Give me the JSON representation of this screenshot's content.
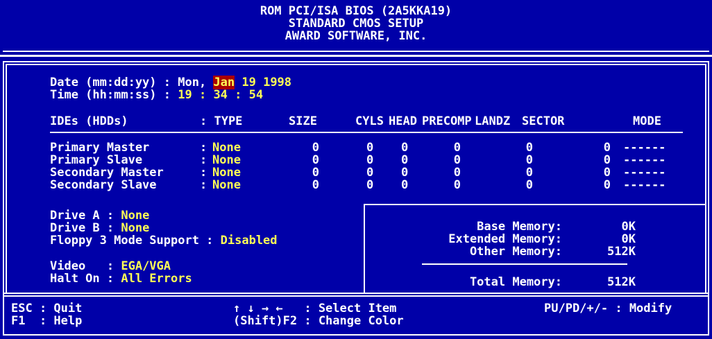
{
  "header": {
    "line1": "ROM PCI/ISA BIOS (2A5KKA19)",
    "line2": "STANDARD CMOS SETUP",
    "line3": "AWARD SOFTWARE, INC."
  },
  "datetime": {
    "date_label": "Date (mm:dd:yy) : ",
    "date_day": "Mon, ",
    "date_month": "Jan",
    "date_rest": " 19 1998",
    "time_label": "Time (hh:mm:ss) : ",
    "time_h": "19",
    "time_sep1": " : ",
    "time_m": "34",
    "time_sep2": " : ",
    "time_s": "54"
  },
  "ide": {
    "headers": [
      "IDEs (HDDs)",
      ": TYPE",
      "SIZE",
      "CYLS",
      "HEAD",
      "PRECOMP",
      "LANDZ",
      "SECTOR",
      "MODE"
    ],
    "rows": [
      {
        "name": "Primary Master",
        "type": "None",
        "size": "0",
        "cyls": "0",
        "head": "0",
        "precomp": "0",
        "landz": "0",
        "sector": "0",
        "mode": "------"
      },
      {
        "name": "Primary Slave",
        "type": "None",
        "size": "0",
        "cyls": "0",
        "head": "0",
        "precomp": "0",
        "landz": "0",
        "sector": "0",
        "mode": "------"
      },
      {
        "name": "Secondary Master",
        "type": "None",
        "size": "0",
        "cyls": "0",
        "head": "0",
        "precomp": "0",
        "landz": "0",
        "sector": "0",
        "mode": "------"
      },
      {
        "name": "Secondary Slave",
        "type": "None",
        "size": "0",
        "cyls": "0",
        "head": "0",
        "precomp": "0",
        "landz": "0",
        "sector": "0",
        "mode": "------"
      }
    ]
  },
  "drives": {
    "drive_a_label": "Drive A : ",
    "drive_a_value": "None",
    "drive_b_label": "Drive B : ",
    "drive_b_value": "None",
    "floppy_label": "Floppy 3 Mode Support : ",
    "floppy_value": "Disabled",
    "video_label": "Video   : ",
    "video_value": "EGA/VGA",
    "halt_label": "Halt On : ",
    "halt_value": "All Errors"
  },
  "memory": {
    "base_label": "Base Memory:",
    "base_value": "0K",
    "extended_label": "Extended Memory:",
    "extended_value": "0K",
    "other_label": "Other Memory:",
    "other_value": "512K",
    "total_label": "Total Memory:",
    "total_value": "512K"
  },
  "footer": {
    "esc": "ESC : Quit",
    "f1": "F1  : Help",
    "arrows": "↑ ↓ → ←   : Select Item",
    "shift_f2": "(Shift)F2 : Change Color",
    "modify": "PU/PD/+/- : Modify"
  },
  "colors": {
    "background": "#0000a8",
    "text": "#ffffff",
    "value": "#ffff55",
    "highlight": "#a80000"
  }
}
